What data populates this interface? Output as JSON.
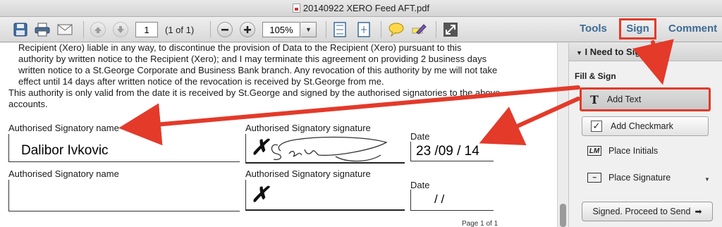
{
  "window": {
    "title": "20140922 XERO Feed AFT.pdf"
  },
  "toolbar": {
    "page_number": "1",
    "page_count": "(1 of 1)",
    "zoom": "105%",
    "tabs": {
      "tools": "Tools",
      "sign": "Sign",
      "comment": "Comment"
    }
  },
  "document": {
    "paragraph_1": "Recipient (Xero) liable in any way, to discontinue the provision of Data to the Recipient (Xero) pursuant to this authority by written notice to the Recipient (Xero); and I may terminate this agreement on providing 2 business days written notice to a St.George Corporate and Business Bank branch. Any revocation of this authority by me will not take effect until 14 days after written notice of the revocation is received by St.George from me.",
    "paragraph_2": "This authority is only valid from the date it is received by St.George and signed by the authorised signatories to the above accounts.",
    "signatory_1": {
      "name_label": "Authorised Signatory name",
      "name_value": "Dalibor Ivkovic",
      "signature_label": "Authorised Signatory signature",
      "x_mark": "✗",
      "date_label": "Date",
      "date_value": "23 /09  / 14"
    },
    "signatory_2": {
      "name_label": "Authorised Signatory name",
      "signature_label": "Authorised Signatory signature",
      "x_mark": "✗",
      "date_label": "Date",
      "date_value": "/       /"
    },
    "page_footer": "Page 1 of 1"
  },
  "panel": {
    "header": "I Need to Sign",
    "section": "Fill & Sign",
    "add_text": "Add Text",
    "add_checkmark": "Add Checkmark",
    "place_initials": "Place Initials",
    "place_signature": "Place Signature",
    "send_button": "Signed. Proceed to Send"
  },
  "icons": {
    "save": "floppy-disk-icon",
    "print": "printer-icon",
    "email": "envelope-icon",
    "prev": "arrow-up-icon",
    "next": "arrow-down-icon",
    "zoom_out": "minus-icon",
    "zoom_in": "plus-icon",
    "fit": "fit-page-icon",
    "comment": "speech-bubble-icon",
    "highlight": "highlighter-icon",
    "fullscreen": "expand-icon"
  },
  "colors": {
    "annotation": "#e33a2a",
    "tab_text": "#3d6b96"
  }
}
